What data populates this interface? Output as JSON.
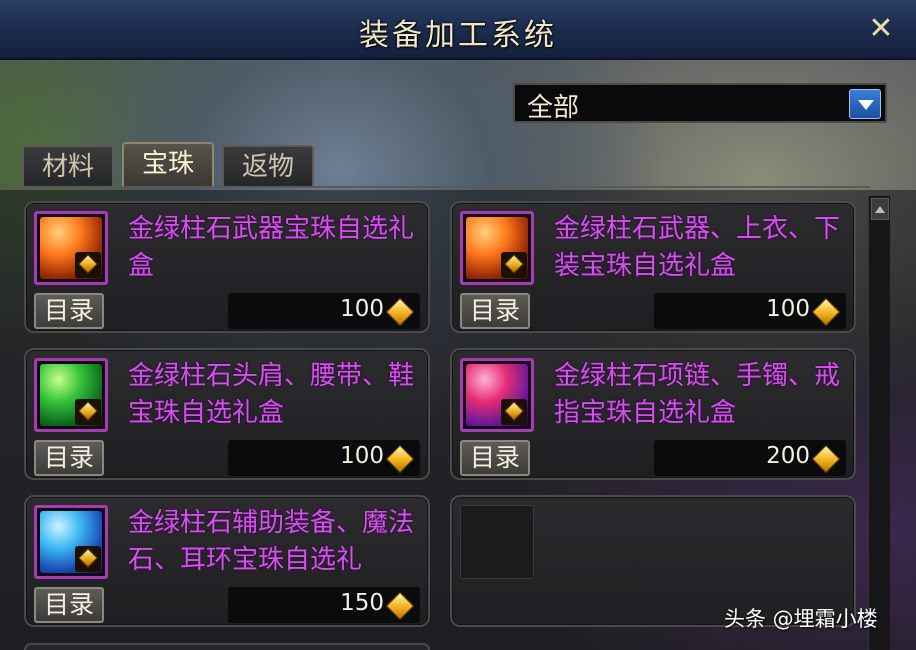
{
  "window": {
    "title": "装备加工系统",
    "close_icon": "close-icon"
  },
  "filter": {
    "selected": "全部",
    "toggle_icon": "chevron-down-icon"
  },
  "tabs": [
    {
      "label": "材料",
      "active": false
    },
    {
      "label": "宝珠",
      "active": true
    },
    {
      "label": "返物",
      "active": false
    }
  ],
  "items": [
    {
      "name": "金绿柱石武器宝珠自选礼盒",
      "catalog_label": "目录",
      "price": "100",
      "gem_color": "#ff7a1c"
    },
    {
      "name": "金绿柱石武器、上衣、下装宝珠自选礼盒",
      "catalog_label": "目录",
      "price": "100",
      "gem_color": "#ff7a1c"
    },
    {
      "name": "金绿柱石头肩、腰带、鞋宝珠自选礼盒",
      "catalog_label": "目录",
      "price": "100",
      "gem_color": "#36c43a"
    },
    {
      "name": "金绿柱石项链、手镯、戒指宝珠自选礼盒",
      "catalog_label": "目录",
      "price": "200",
      "gem_color": "#e62c74"
    },
    {
      "name": "金绿柱石辅助装备、魔法石、耳环宝珠自选礼",
      "catalog_label": "目录",
      "price": "150",
      "gem_color": "#3ab6f2"
    }
  ],
  "colors": {
    "item_name": "#d64ff0",
    "title_bar": "#1b2b4d",
    "frame": "#a53cb2",
    "coin": "#f2b21c"
  },
  "watermark": "头条 @埋霜小楼"
}
